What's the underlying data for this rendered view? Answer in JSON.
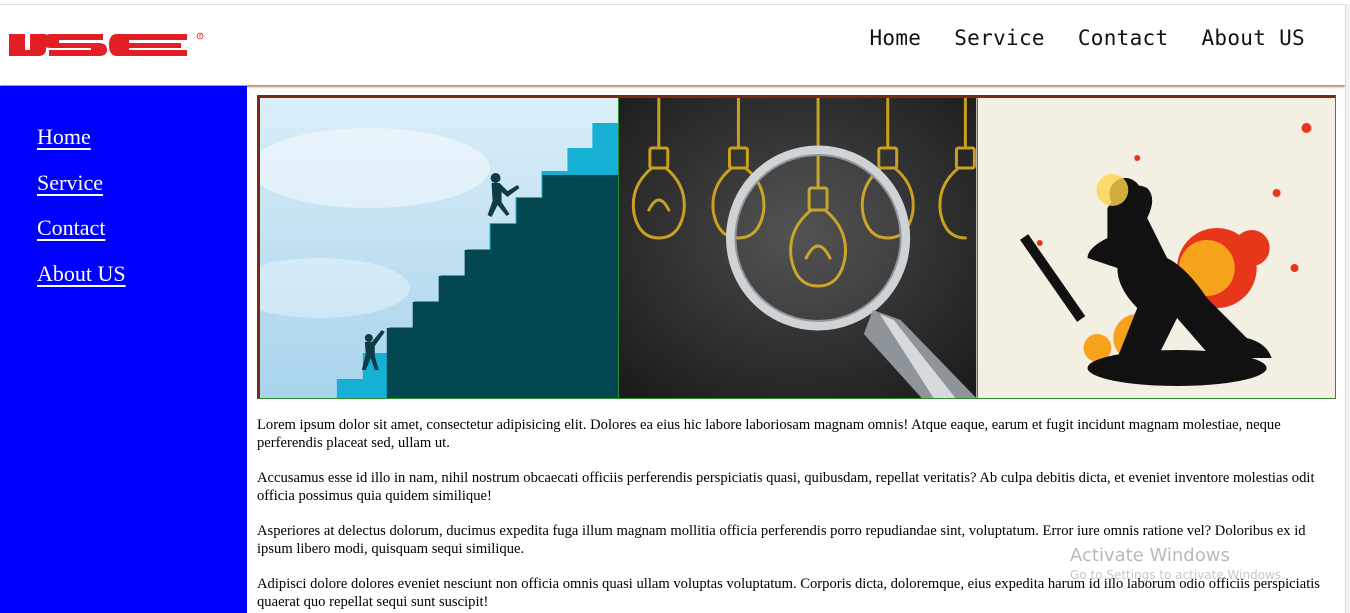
{
  "brand": {
    "logo_text": "IJSE",
    "registered_mark": "®",
    "logo_color": "#e31e24"
  },
  "top_nav": [
    "Home",
    "Service",
    "Contact",
    "About US"
  ],
  "side_nav": [
    "Home",
    "Service",
    "Contact",
    "About US"
  ],
  "colors": {
    "sidebar_bg": "#0000ff",
    "gallery_border": "#7a2a10",
    "tile_divider": "#2e8b2e"
  },
  "gallery": [
    {
      "name": "stairs-climbing-illustration"
    },
    {
      "name": "lightbulbs-magnifying-glass-illustration"
    },
    {
      "name": "cricket-batsman-paint-splash-illustration"
    }
  ],
  "paragraphs": [
    "Lorem ipsum dolor sit amet, consectetur adipisicing elit. Dolores ea eius hic labore laboriosam magnam omnis! Atque eaque, earum et fugit incidunt magnam molestiae, neque perferendis placeat sed, ullam ut.",
    "Accusamus esse id illo in nam, nihil nostrum obcaecati officiis perferendis perspiciatis quasi, quibusdam, repellat veritatis? Ab culpa debitis dicta, et eveniet inventore molestias odit officia possimus quia quidem similique!",
    "Asperiores at delectus dolorum, ducimus expedita fuga illum magnam mollitia officia perferendis porro repudiandae sint, voluptatum. Error iure omnis ratione vel? Doloribus ex id ipsum libero modi, quisquam sequi similique.",
    "Adipisci dolore dolores eveniet nesciunt non officia omnis quasi ullam voluptas voluptatum. Corporis dicta, doloremque, eius expedita harum id illo laborum odio officiis perspiciatis quaerat quo repellat sequi sunt suscipit!"
  ],
  "watermark": {
    "title": "Activate Windows",
    "subtitle": "Go to Settings to activate Windows."
  }
}
